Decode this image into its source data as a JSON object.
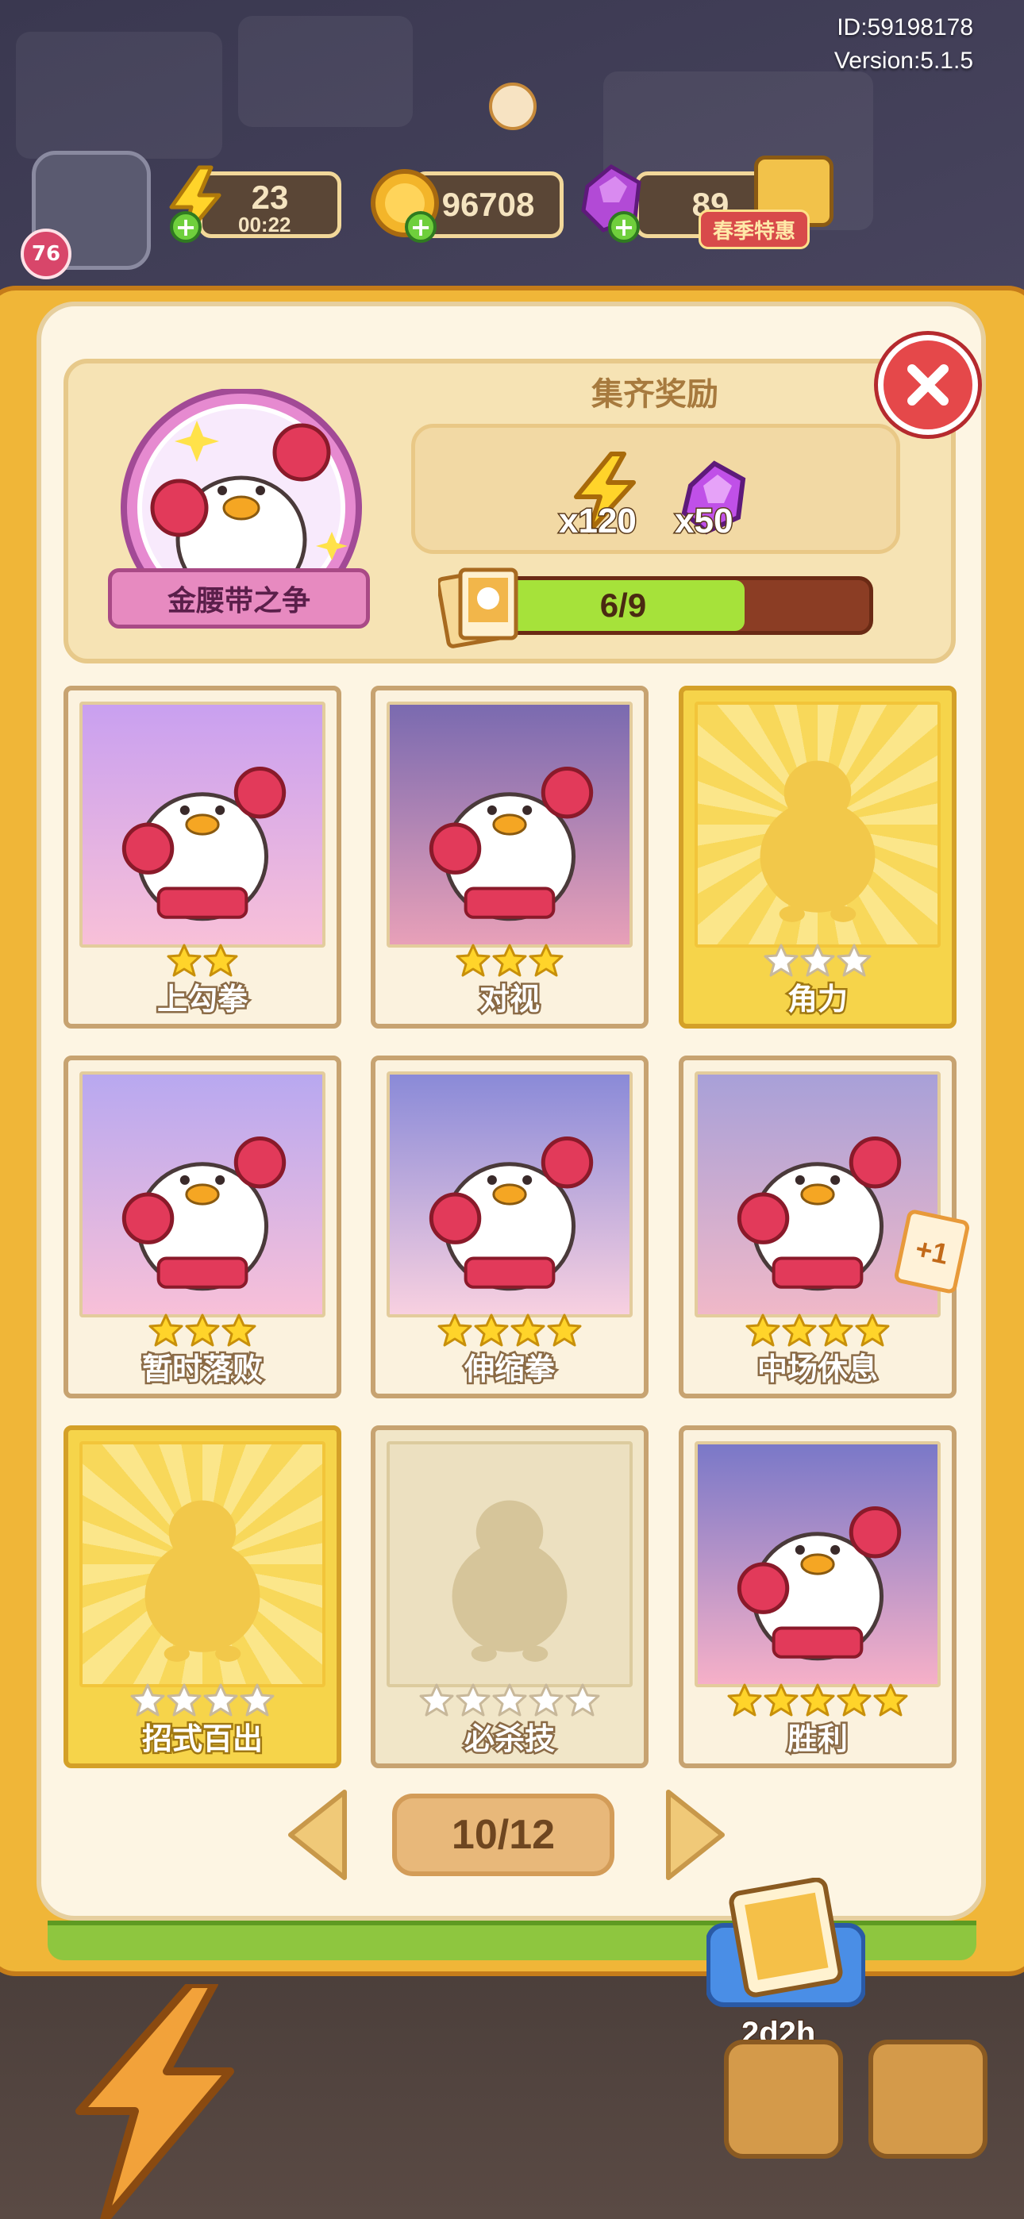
{
  "debug": {
    "id": "ID:59198178",
    "version": "Version:5.1.5"
  },
  "hud": {
    "level": "76",
    "energy": "23",
    "energy_timer": "00:22",
    "coins": "96708",
    "gems": "89",
    "promo": "春季特惠"
  },
  "album": {
    "name": "金腰带之争",
    "reward_title": "集齐奖励",
    "rewards": [
      {
        "icon": "lightning-icon",
        "qty": "x120"
      },
      {
        "icon": "gem-icon",
        "qty": "x50"
      }
    ],
    "progress_text": "6/9",
    "progress_fraction": 0.667
  },
  "cards": [
    {
      "name": "上勾拳",
      "stars": 2,
      "collected": true
    },
    {
      "name": "对视",
      "stars": 3,
      "collected": true
    },
    {
      "name": "角力",
      "stars": 3,
      "collected": false,
      "frame": "gold"
    },
    {
      "name": "暂时落败",
      "stars": 3,
      "collected": true
    },
    {
      "name": "伸缩拳",
      "stars": 4,
      "collected": true
    },
    {
      "name": "中场休息",
      "stars": 4,
      "collected": true,
      "badge": "+1"
    },
    {
      "name": "招式百出",
      "stars": 4,
      "collected": false,
      "frame": "gold"
    },
    {
      "name": "必杀技",
      "stars": 5,
      "collected": false,
      "frame": "pale"
    },
    {
      "name": "胜利",
      "stars": 5,
      "collected": true
    }
  ],
  "pagination": {
    "label": "10/12"
  },
  "card_pack": {
    "timer": "2d2h"
  },
  "colors": {
    "book_gold": "#f0b638",
    "page_cream": "#fdf5e3",
    "star_yellow": "#ffd42a",
    "close_red": "#e5484a",
    "progress_green": "#a6e23a"
  }
}
